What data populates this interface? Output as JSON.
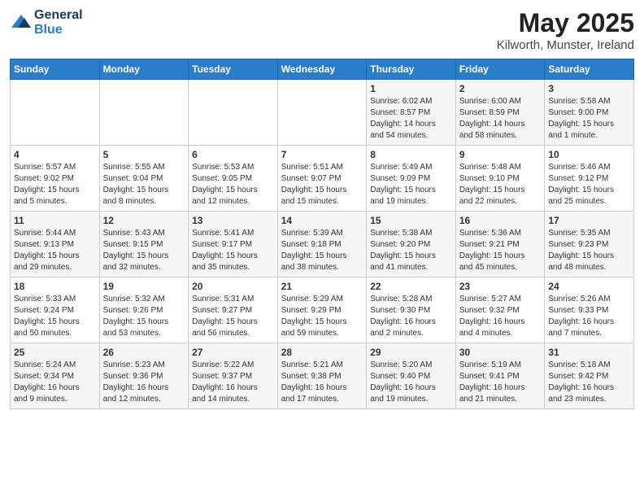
{
  "header": {
    "logo_line1": "General",
    "logo_line2": "Blue",
    "month": "May 2025",
    "location": "Kilworth, Munster, Ireland"
  },
  "days_of_week": [
    "Sunday",
    "Monday",
    "Tuesday",
    "Wednesday",
    "Thursday",
    "Friday",
    "Saturday"
  ],
  "weeks": [
    [
      {
        "day": "",
        "info": ""
      },
      {
        "day": "",
        "info": ""
      },
      {
        "day": "",
        "info": ""
      },
      {
        "day": "",
        "info": ""
      },
      {
        "day": "1",
        "info": "Sunrise: 6:02 AM\nSunset: 8:57 PM\nDaylight: 14 hours\nand 54 minutes."
      },
      {
        "day": "2",
        "info": "Sunrise: 6:00 AM\nSunset: 8:59 PM\nDaylight: 14 hours\nand 58 minutes."
      },
      {
        "day": "3",
        "info": "Sunrise: 5:58 AM\nSunset: 9:00 PM\nDaylight: 15 hours\nand 1 minute."
      }
    ],
    [
      {
        "day": "4",
        "info": "Sunrise: 5:57 AM\nSunset: 9:02 PM\nDaylight: 15 hours\nand 5 minutes."
      },
      {
        "day": "5",
        "info": "Sunrise: 5:55 AM\nSunset: 9:04 PM\nDaylight: 15 hours\nand 8 minutes."
      },
      {
        "day": "6",
        "info": "Sunrise: 5:53 AM\nSunset: 9:05 PM\nDaylight: 15 hours\nand 12 minutes."
      },
      {
        "day": "7",
        "info": "Sunrise: 5:51 AM\nSunset: 9:07 PM\nDaylight: 15 hours\nand 15 minutes."
      },
      {
        "day": "8",
        "info": "Sunrise: 5:49 AM\nSunset: 9:09 PM\nDaylight: 15 hours\nand 19 minutes."
      },
      {
        "day": "9",
        "info": "Sunrise: 5:48 AM\nSunset: 9:10 PM\nDaylight: 15 hours\nand 22 minutes."
      },
      {
        "day": "10",
        "info": "Sunrise: 5:46 AM\nSunset: 9:12 PM\nDaylight: 15 hours\nand 25 minutes."
      }
    ],
    [
      {
        "day": "11",
        "info": "Sunrise: 5:44 AM\nSunset: 9:13 PM\nDaylight: 15 hours\nand 29 minutes."
      },
      {
        "day": "12",
        "info": "Sunrise: 5:43 AM\nSunset: 9:15 PM\nDaylight: 15 hours\nand 32 minutes."
      },
      {
        "day": "13",
        "info": "Sunrise: 5:41 AM\nSunset: 9:17 PM\nDaylight: 15 hours\nand 35 minutes."
      },
      {
        "day": "14",
        "info": "Sunrise: 5:39 AM\nSunset: 9:18 PM\nDaylight: 15 hours\nand 38 minutes."
      },
      {
        "day": "15",
        "info": "Sunrise: 5:38 AM\nSunset: 9:20 PM\nDaylight: 15 hours\nand 41 minutes."
      },
      {
        "day": "16",
        "info": "Sunrise: 5:36 AM\nSunset: 9:21 PM\nDaylight: 15 hours\nand 45 minutes."
      },
      {
        "day": "17",
        "info": "Sunrise: 5:35 AM\nSunset: 9:23 PM\nDaylight: 15 hours\nand 48 minutes."
      }
    ],
    [
      {
        "day": "18",
        "info": "Sunrise: 5:33 AM\nSunset: 9:24 PM\nDaylight: 15 hours\nand 50 minutes."
      },
      {
        "day": "19",
        "info": "Sunrise: 5:32 AM\nSunset: 9:26 PM\nDaylight: 15 hours\nand 53 minutes."
      },
      {
        "day": "20",
        "info": "Sunrise: 5:31 AM\nSunset: 9:27 PM\nDaylight: 15 hours\nand 56 minutes."
      },
      {
        "day": "21",
        "info": "Sunrise: 5:29 AM\nSunset: 9:29 PM\nDaylight: 15 hours\nand 59 minutes."
      },
      {
        "day": "22",
        "info": "Sunrise: 5:28 AM\nSunset: 9:30 PM\nDaylight: 16 hours\nand 2 minutes."
      },
      {
        "day": "23",
        "info": "Sunrise: 5:27 AM\nSunset: 9:32 PM\nDaylight: 16 hours\nand 4 minutes."
      },
      {
        "day": "24",
        "info": "Sunrise: 5:26 AM\nSunset: 9:33 PM\nDaylight: 16 hours\nand 7 minutes."
      }
    ],
    [
      {
        "day": "25",
        "info": "Sunrise: 5:24 AM\nSunset: 9:34 PM\nDaylight: 16 hours\nand 9 minutes."
      },
      {
        "day": "26",
        "info": "Sunrise: 5:23 AM\nSunset: 9:36 PM\nDaylight: 16 hours\nand 12 minutes."
      },
      {
        "day": "27",
        "info": "Sunrise: 5:22 AM\nSunset: 9:37 PM\nDaylight: 16 hours\nand 14 minutes."
      },
      {
        "day": "28",
        "info": "Sunrise: 5:21 AM\nSunset: 9:38 PM\nDaylight: 16 hours\nand 17 minutes."
      },
      {
        "day": "29",
        "info": "Sunrise: 5:20 AM\nSunset: 9:40 PM\nDaylight: 16 hours\nand 19 minutes."
      },
      {
        "day": "30",
        "info": "Sunrise: 5:19 AM\nSunset: 9:41 PM\nDaylight: 16 hours\nand 21 minutes."
      },
      {
        "day": "31",
        "info": "Sunrise: 5:18 AM\nSunset: 9:42 PM\nDaylight: 16 hours\nand 23 minutes."
      }
    ]
  ]
}
